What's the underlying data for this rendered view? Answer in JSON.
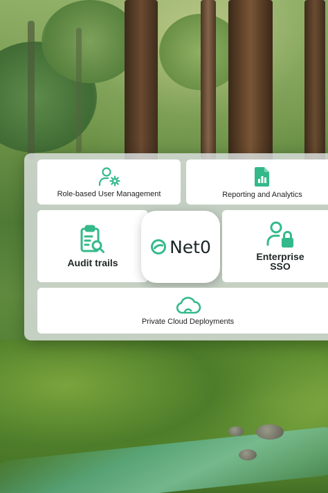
{
  "brand": {
    "name": "Net0",
    "accent_color": "#34b98a"
  },
  "features": {
    "role": {
      "label": "Role-based User Management",
      "icon": "user-gear-icon"
    },
    "reporting": {
      "label": "Reporting and Analytics",
      "icon": "report-document-icon"
    },
    "audit": {
      "label": "Audit trails",
      "icon": "clipboard-search-icon"
    },
    "sso": {
      "line1": "Enterprise",
      "line2": "SSO",
      "icon": "user-lock-icon"
    },
    "cloud": {
      "label": "Private Cloud Deployments",
      "icon": "cloud-icon"
    }
  }
}
